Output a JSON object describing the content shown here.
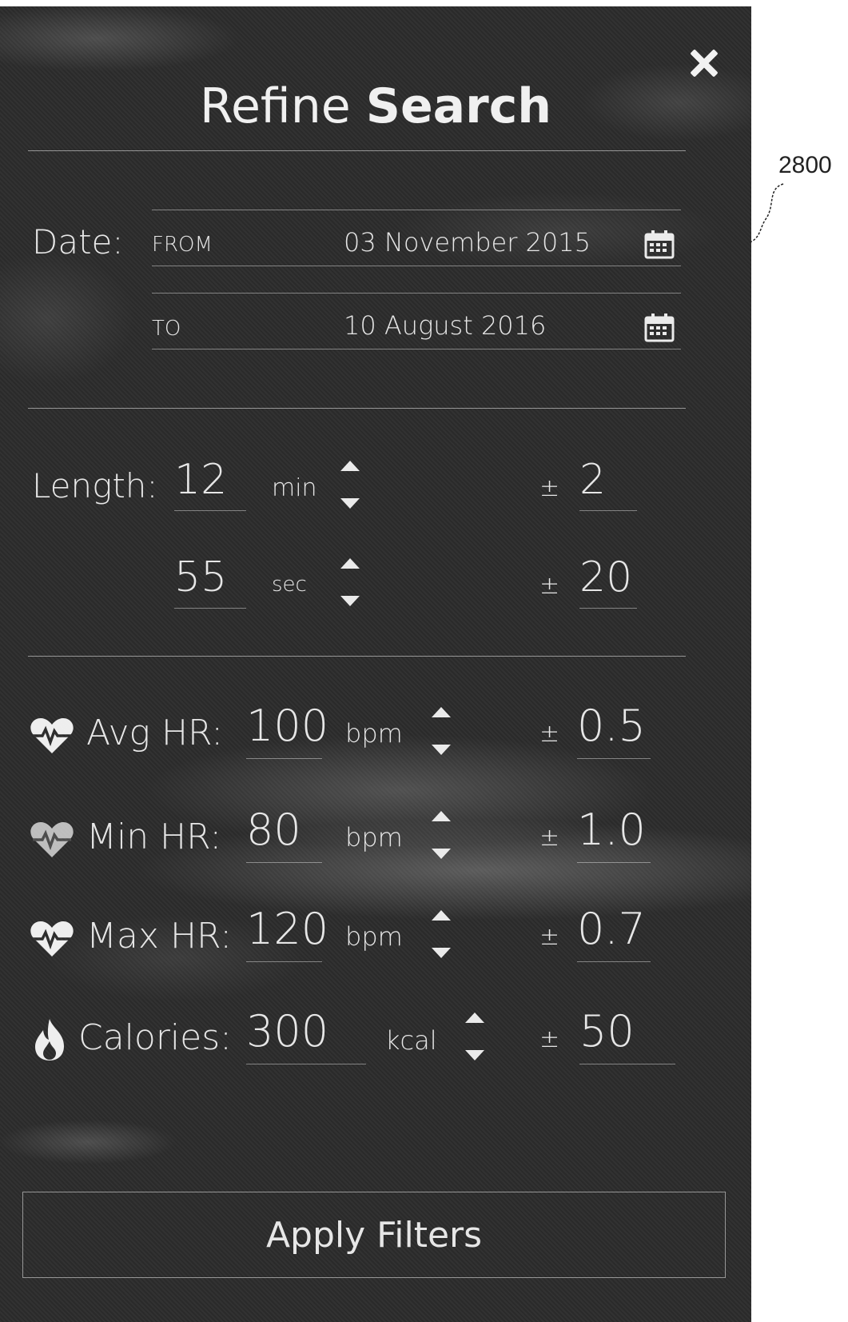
{
  "annotation": {
    "reference_number": "2800"
  },
  "panel": {
    "title_light": "Refine",
    "title_bold": "Search",
    "close_icon": "close-icon"
  },
  "date": {
    "label": "Date:",
    "from_label": "FROM",
    "from_value": "03 November 2015",
    "to_label": "TO",
    "to_value": "10 August 2016",
    "icon": "calendar-icon"
  },
  "length": {
    "label": "Length:",
    "minutes": {
      "value": "12",
      "unit": "min",
      "tolerance_sign": "±",
      "tolerance": "2"
    },
    "seconds": {
      "value": "55",
      "unit": "sec",
      "tolerance_sign": "±",
      "tolerance": "20"
    }
  },
  "metrics": [
    {
      "label": "Avg HR:",
      "value": "100",
      "unit": "bpm",
      "tolerance_sign": "±",
      "tolerance": "0.5",
      "icon": "heartbeat-icon"
    },
    {
      "label": "Min HR:",
      "value": "80",
      "unit": "bpm",
      "tolerance_sign": "±",
      "tolerance": "1.0",
      "icon": "heartbeat-icon"
    },
    {
      "label": "Max HR:",
      "value": "120",
      "unit": "bpm",
      "tolerance_sign": "±",
      "tolerance": "0.7",
      "icon": "heartbeat-icon"
    },
    {
      "label": "Calories:",
      "value": "300",
      "unit": "kcal",
      "tolerance_sign": "±",
      "tolerance": "50",
      "icon": "flame-icon"
    }
  ],
  "actions": {
    "apply_label": "Apply Filters"
  },
  "colors": {
    "panel_background": "#2a2a2a",
    "text": "#e9e9e9"
  }
}
